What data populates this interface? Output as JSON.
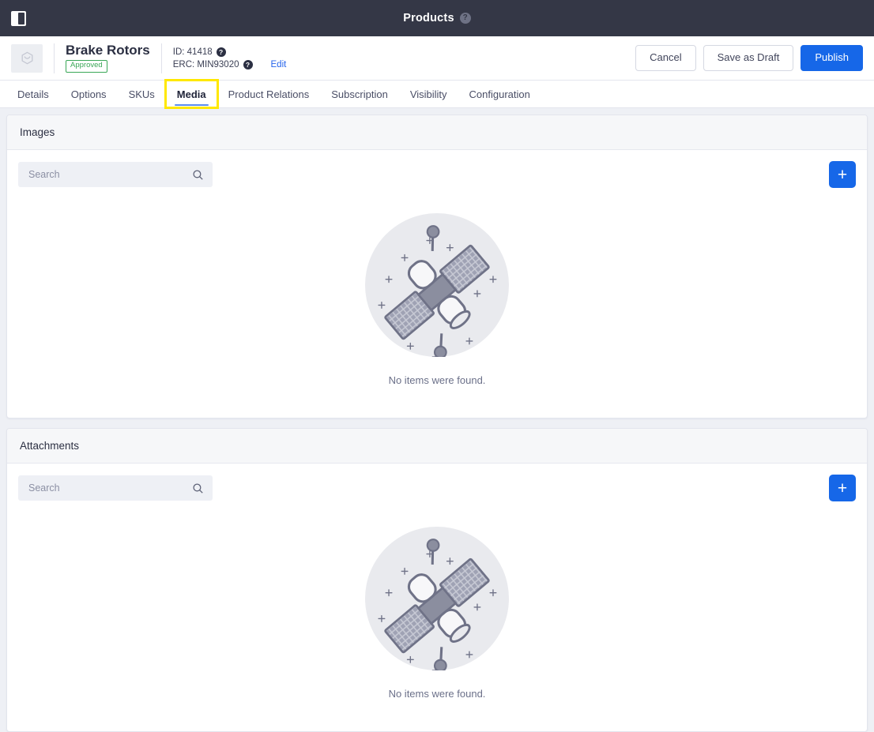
{
  "topbar": {
    "toggle_icon": "sidebar-toggle-icon",
    "title": "Products",
    "help_icon": "?"
  },
  "product": {
    "thumbnail_icon": "package-icon",
    "name": "Brake Rotors",
    "status_badge": "Approved",
    "id_label": "ID: 41418",
    "erc_label": "ERC: MIN93020",
    "help_icon": "?",
    "edit_link": "Edit"
  },
  "actions": {
    "cancel": "Cancel",
    "save_draft": "Save as Draft",
    "publish": "Publish"
  },
  "tabs": [
    {
      "label": "Details",
      "active": false
    },
    {
      "label": "Options",
      "active": false
    },
    {
      "label": "SKUs",
      "active": false
    },
    {
      "label": "Media",
      "active": true
    },
    {
      "label": "Product Relations",
      "active": false
    },
    {
      "label": "Subscription",
      "active": false
    },
    {
      "label": "Visibility",
      "active": false
    },
    {
      "label": "Configuration",
      "active": false
    }
  ],
  "sections": [
    {
      "title": "Images",
      "search_placeholder": "Search",
      "search_value": "",
      "add_label": "+",
      "empty_text": "No items were found."
    },
    {
      "title": "Attachments",
      "search_placeholder": "Search",
      "search_value": "",
      "add_label": "+",
      "empty_text": "No items were found."
    }
  ],
  "colors": {
    "navbar": "#343746",
    "primary": "#1667e8",
    "page_bg": "#eef0f5",
    "approved": "#3aa757",
    "highlight": "#ffe800",
    "link": "#2563eb"
  }
}
